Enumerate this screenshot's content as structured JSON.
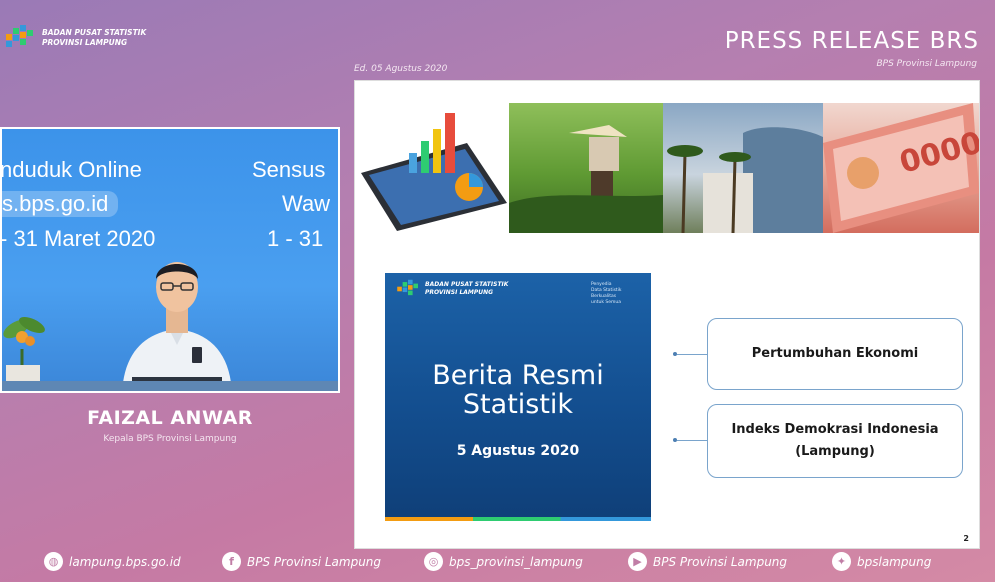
{
  "header": {
    "org_line1": "BADAN PUSAT STATISTIK",
    "org_line2": "PROVINSI LAMPUNG",
    "title": "PRESS RELEASE BRS",
    "subtitle": "BPS Provinsi Lampung",
    "edition": "Ed. 05 Agustus 2020"
  },
  "video": {
    "banner_left_1": "nduduk Online",
    "banner_left_2": "s.bps.go.id",
    "banner_left_3": "- 31 Maret 2020",
    "banner_right_1": "Sensus",
    "banner_right_2": "Waw",
    "banner_right_3": "1 - 31"
  },
  "speaker": {
    "name": "FAIZAL ANWAR",
    "role": "Kepala BPS Provinsi Lampung"
  },
  "slide": {
    "brs_org_line1": "BADAN PUSAT STATISTIK",
    "brs_org_line2": "PROVINSI LAMPUNG",
    "brs_tagline_1": "Penyedia",
    "brs_tagline_2": "Data Statistik",
    "brs_tagline_3": "Berkualitas",
    "brs_tagline_4": "untuk Semua",
    "brs_title_1": "Berita Resmi",
    "brs_title_2": "Statistik",
    "brs_date": "5 Agustus 2020",
    "topics": [
      {
        "label": "Pertumbuhan Ekonomi"
      },
      {
        "label": "Indeks Demokrasi Indonesia (Lampung)"
      }
    ],
    "page_number": "2"
  },
  "footer": {
    "website": "lampung.bps.go.id",
    "facebook": "BPS Provinsi Lampung",
    "instagram": "bps_provinsi_lampung",
    "youtube": "BPS Provinsi Lampung",
    "twitter": "bpslampung"
  },
  "colors": {
    "accent_pink": "#c57aa4",
    "slide_blue": "#134e8f",
    "topic_border": "#7aa4cc"
  }
}
